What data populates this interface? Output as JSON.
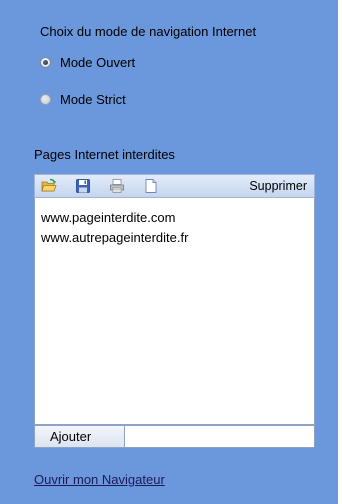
{
  "navigation_mode": {
    "title": "Choix du mode de navigation Internet",
    "options": [
      {
        "label": "Mode Ouvert",
        "selected": true
      },
      {
        "label": "Mode Strict",
        "selected": false
      }
    ]
  },
  "blocked_pages": {
    "title": "Pages Internet interdites",
    "toolbar": {
      "icons": [
        "open-folder-icon",
        "save-icon",
        "print-icon",
        "new-document-icon"
      ],
      "delete_label": "Supprimer"
    },
    "items": [
      "www.pageinterdite.com",
      "www.autrepageinterdite.fr"
    ],
    "add_label": "Ajouter",
    "add_input_value": ""
  },
  "open_browser_link": "Ouvrir mon Navigateur",
  "colors": {
    "panel_background": "#6b97dc",
    "toolbar_gradient_top": "#e3ecfb",
    "toolbar_gradient_bottom": "#c4d5ee"
  }
}
